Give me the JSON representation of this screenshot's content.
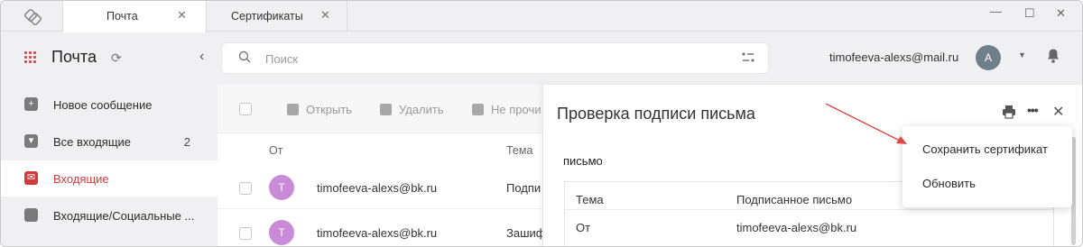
{
  "tabs": [
    {
      "label": "Почта",
      "active": true
    },
    {
      "label": "Сертификаты",
      "active": false
    }
  ],
  "window_controls": {
    "minimize": "—",
    "maximize": "☐",
    "close": "✕"
  },
  "header": {
    "app_title": "Почта",
    "search_placeholder": "Поиск",
    "user_email": "timofeeva-alexs@mail.ru",
    "avatar_letter": "A"
  },
  "sidebar": {
    "items": [
      {
        "label": "Новое сообщение",
        "count": ""
      },
      {
        "label": "Все входящие",
        "count": "2"
      },
      {
        "label": "Входящие",
        "count": "",
        "active": true
      },
      {
        "label": "Входящие/Социальные ...",
        "count": ""
      }
    ]
  },
  "toolbar": {
    "open": "Открыть",
    "delete": "Удалить",
    "unread": "Не прочи"
  },
  "list": {
    "col_from": "От",
    "col_subject": "Тема",
    "rows": [
      {
        "avatar": "T",
        "from": "timofeeva-alexs@bk.ru",
        "subject": "Подпи"
      },
      {
        "avatar": "T",
        "from": "timofeeva-alexs@bk.ru",
        "subject": "Зашиф"
      }
    ]
  },
  "dialog": {
    "title": "Проверка подписи письма",
    "section": "письмо",
    "rows": [
      {
        "key": "Тема",
        "value": "Подписанное письмо"
      },
      {
        "key": "От",
        "value": "timofeeva-alexs@bk.ru"
      }
    ]
  },
  "menu": {
    "items": [
      "Сохранить сертификат",
      "Обновить"
    ]
  },
  "colors": {
    "accent": "#d23a3a",
    "annotation_arrow": "#e04848",
    "avatar_user": "#6f7f8c",
    "avatar_contact": "#c98ad8"
  }
}
